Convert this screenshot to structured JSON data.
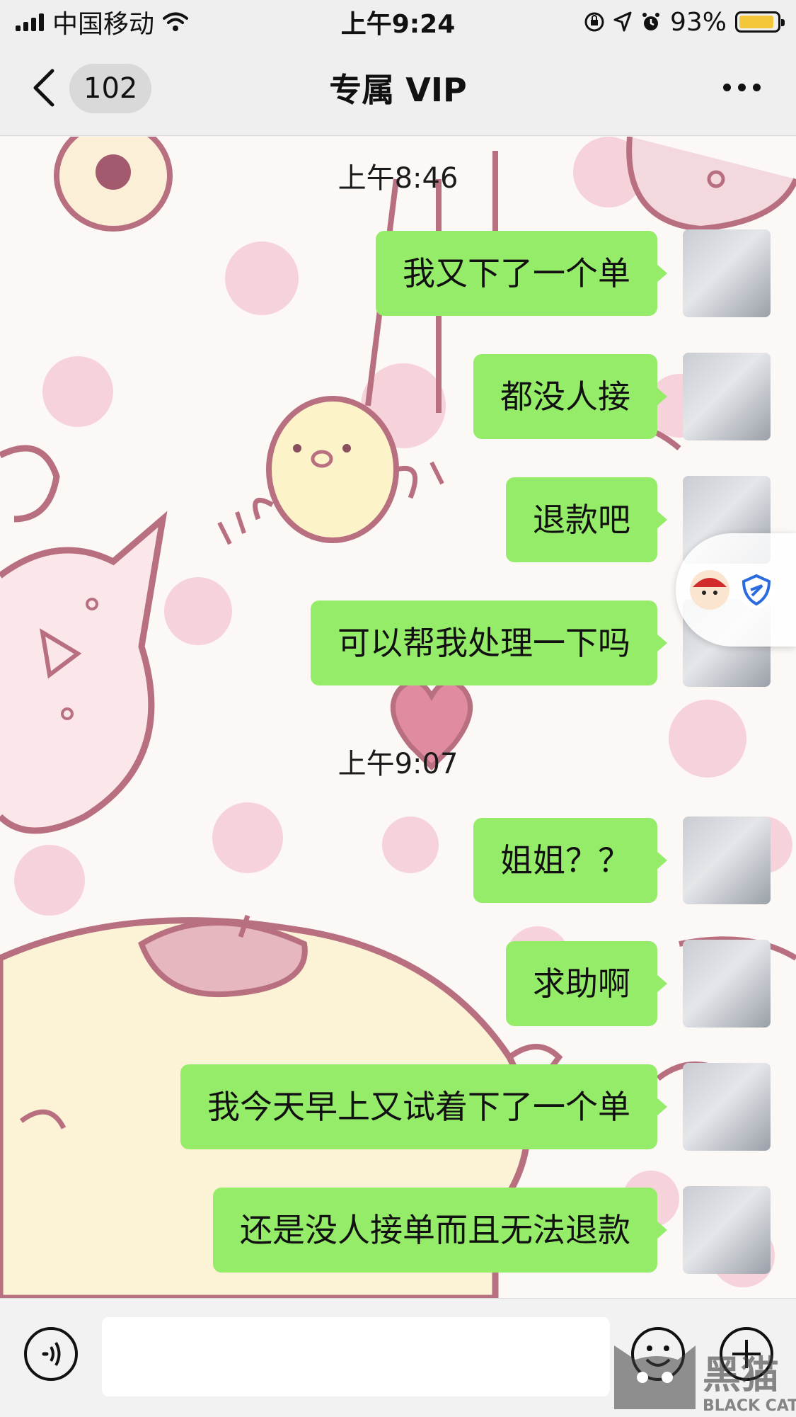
{
  "status_bar": {
    "carrier": "中国移动",
    "time": "上午9:24",
    "battery": "93%",
    "battery_level": 0.93
  },
  "nav": {
    "unread_count": "102",
    "title": "专属 VIP"
  },
  "messages": [
    {
      "type": "timestamp",
      "text": "上午8:46"
    },
    {
      "type": "sent",
      "text": "我又下了一个单"
    },
    {
      "type": "sent",
      "text": "都没人接"
    },
    {
      "type": "sent",
      "text": "退款吧"
    },
    {
      "type": "sent",
      "text": "可以帮我处理一下吗"
    },
    {
      "type": "timestamp",
      "text": "上午9:07"
    },
    {
      "type": "sent",
      "text": "姐姐？？"
    },
    {
      "type": "sent",
      "text": "求助啊"
    },
    {
      "type": "sent",
      "text": "我今天早上又试着下了一个单"
    },
    {
      "type": "sent",
      "text": "还是没人接单而且无法退款"
    }
  ],
  "input": {
    "value": "",
    "placeholder": ""
  },
  "watermark": {
    "text_cn": "黑猫",
    "text_en": "BLACK CAT"
  },
  "colors": {
    "bubble_sent": "#95ec69",
    "bar_background": "#efefef",
    "battery_fill": "#f4c73b",
    "wallpaper_pink": "#f3c6cf",
    "wallpaper_outline": "#b86f80"
  },
  "icons": {
    "back": "chevron-left-icon",
    "more": "more-dots-icon",
    "voice": "voice-icon",
    "emoji": "emoji-icon",
    "plus": "plus-icon",
    "wifi": "wifi-icon",
    "location": "location-icon",
    "alarm": "alarm-icon",
    "rotation_lock": "rotation-lock-icon"
  }
}
